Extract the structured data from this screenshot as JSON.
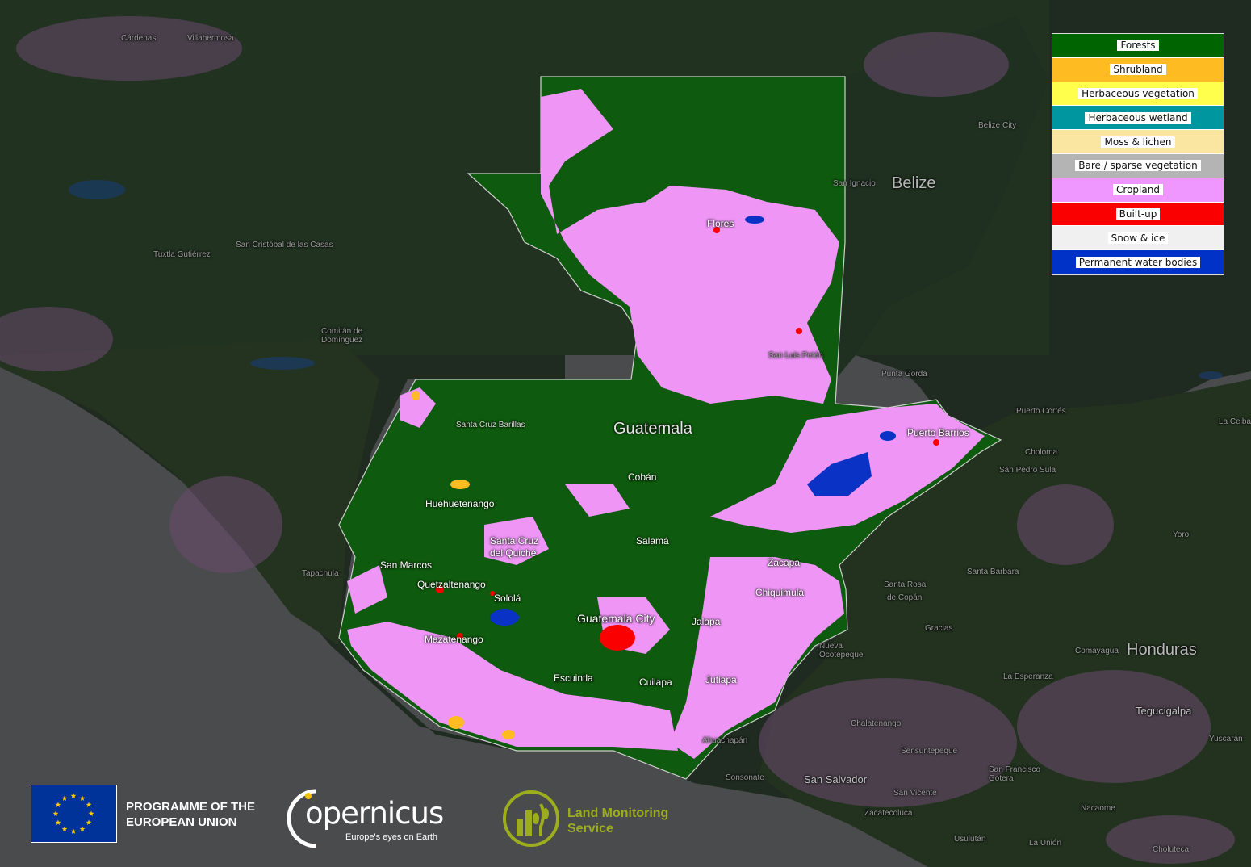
{
  "legend": [
    {
      "label": "Forests",
      "color": "#006400"
    },
    {
      "label": "Shrubland",
      "color": "#ffbb22"
    },
    {
      "label": "Herbaceous vegetation",
      "color": "#ffff4c"
    },
    {
      "label": "Herbaceous wetland",
      "color": "#0096a0"
    },
    {
      "label": "Moss & lichen",
      "color": "#fae6a0"
    },
    {
      "label": "Bare / sparse vegetation",
      "color": "#b4b4b4"
    },
    {
      "label": "Cropland",
      "color": "#f096ff"
    },
    {
      "label": "Built-up",
      "color": "#fa0000"
    },
    {
      "label": "Snow & ice",
      "color": "#f0f0f0"
    },
    {
      "label": "Permanent water bodies",
      "color": "#0032c8"
    }
  ],
  "map": {
    "country": "Guatemala",
    "neighbors": {
      "belize": "Belize",
      "honduras": "Honduras"
    },
    "places": {
      "cardenas": "Cárdenas",
      "villahermosa": "Villahermosa",
      "san_cristobal": "San Cristóbal de las Casas",
      "tuxtla": "Tuxtla Gutiérrez",
      "comitan": "Comitán de Domínguez",
      "tapachula": "Tapachula",
      "belize_city": "Belize City",
      "san_ignacio": "San Ignacio",
      "flores": "Flores",
      "san_luis": "San Luis Petén",
      "santa_cruz_barillas": "Santa Cruz Barillas",
      "coban": "Cobán",
      "huehuetenango": "Huehuetenango",
      "salama": "Salamá",
      "santa_cruz_quiche_1": "Santa Cruz",
      "santa_cruz_quiche_2": "del Quiché",
      "san_marcos": "San Marcos",
      "quetzaltenango": "Quetzaltenango",
      "solola": "Sololá",
      "guatemala_city": "Guatemala City",
      "mazatenango": "Mazatenango",
      "escuintla": "Escuintla",
      "cuilapa": "Cuilapa",
      "jalapa": "Jalapa",
      "jutiapa": "Jutiapa",
      "zacapa": "Zacapa",
      "chiquimula": "Chiquimula",
      "puerto_barrios": "Puerto Barrios",
      "puerto_cortes": "Puerto Cortés",
      "choloma": "Choloma",
      "san_pedro_sula": "San Pedro Sula",
      "la_ceiba": "La Ceiba",
      "santa_barbara": "Santa Barbara",
      "yoro": "Yoro",
      "santa_rosa_1": "Santa Rosa",
      "santa_rosa_2": "de Copán",
      "gracias": "Gracias",
      "comayagua": "Comayagua",
      "la_esperanza": "La Esperanza",
      "tegucigalpa": "Tegucigalpa",
      "yuscaran": "Yuscarán",
      "nueva_ocotepeque": "Nueva Ocotepeque",
      "chalatenango": "Chalatenango",
      "ahuachapan": "Ahuachapán",
      "sonsonate": "Sonsonate",
      "san_salvador": "San Salvador",
      "sensuntepeque": "Sensuntepeque",
      "san_francisco_gotera": "San Francisco Gotera",
      "san_vicente": "San Vicente",
      "zacatecoluca": "Zacatecoluca",
      "nacaome": "Nacaome",
      "la_union": "La Unión",
      "usulutan": "Usulután",
      "choluteca": "Choluteca",
      "punta_gorda": "Punta Gorda"
    }
  },
  "footer": {
    "eu_line1": "PROGRAMME OF THE",
    "eu_line2": "EUROPEAN UNION",
    "copernicus_name": "opernicus",
    "copernicus_tagline": "Europe's eyes on Earth",
    "lms_line1": "Land Monitoring",
    "lms_line2": "Service"
  }
}
